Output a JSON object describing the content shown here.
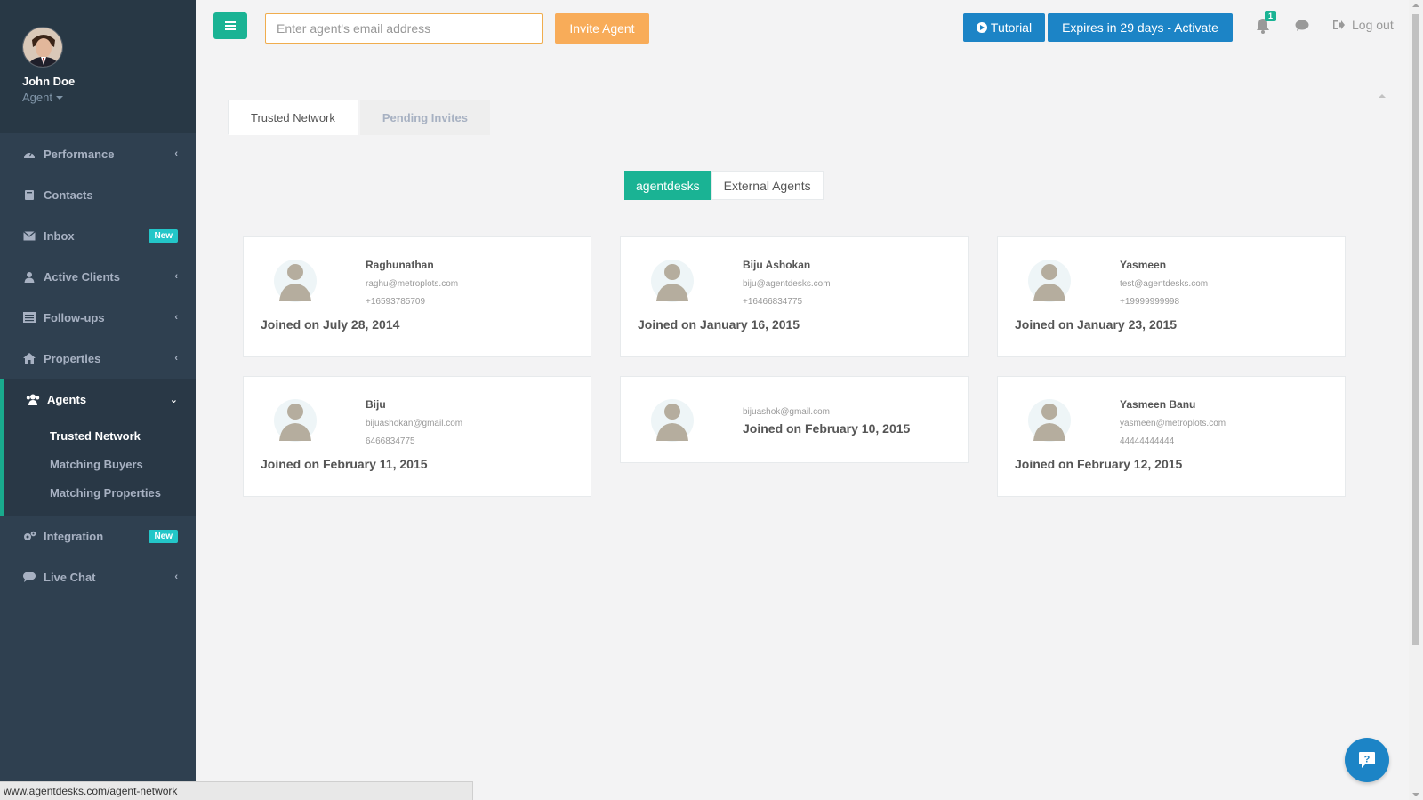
{
  "profile": {
    "name": "John Doe",
    "role": "Agent"
  },
  "sidebar": {
    "items": [
      {
        "label": "Performance",
        "icon": "dashboard-icon"
      },
      {
        "label": "Contacts",
        "icon": "book-icon"
      },
      {
        "label": "Inbox",
        "icon": "envelope-icon",
        "badge": "New"
      },
      {
        "label": "Active Clients",
        "icon": "user-icon"
      },
      {
        "label": "Follow-ups",
        "icon": "list-icon"
      },
      {
        "label": "Properties",
        "icon": "home-icon"
      },
      {
        "label": "Agents",
        "icon": "users-icon"
      },
      {
        "label": "Integration",
        "icon": "gears-icon",
        "badge": "New"
      },
      {
        "label": "Live Chat",
        "icon": "comment-icon"
      }
    ],
    "agents_sub": [
      "Trusted Network",
      "Matching Buyers",
      "Matching Properties"
    ]
  },
  "topbar": {
    "email_placeholder": "Enter agent's email address",
    "invite_label": "Invite Agent",
    "tutorial_label": "Tutorial",
    "expires_label": "Expires in 29 days - Activate",
    "notification_count": "1",
    "logout_label": "Log out"
  },
  "tabs": {
    "trusted": "Trusted Network",
    "pending": "Pending Invites"
  },
  "segments": {
    "on": "agentdesks",
    "off": "External Agents"
  },
  "agents": [
    {
      "name": "Raghunathan",
      "email": "raghu@metroplots.com",
      "phone": "+16593785709",
      "joined": "Joined on July 28, 2014"
    },
    {
      "name": "Biju Ashokan",
      "email": "biju@agentdesks.com",
      "phone": "+16466834775",
      "joined": "Joined on January 16, 2015"
    },
    {
      "name": "Yasmeen",
      "email": "test@agentdesks.com",
      "phone": "+19999999998",
      "joined": "Joined on January 23, 2015"
    },
    {
      "name": "Biju",
      "email": "bijuashokan@gmail.com",
      "phone": "6466834775",
      "joined": "Joined on February 11, 2015"
    },
    {
      "name": "",
      "email": "bijuashok@gmail.com",
      "phone": "",
      "joined": "Joined on February 10, 2015"
    },
    {
      "name": "Yasmeen Banu",
      "email": "yasmeen@metroplots.com",
      "phone": "44444444444",
      "joined": "Joined on February 12, 2015"
    }
  ],
  "status_url": "www.agentdesks.com/agent-network",
  "colors": {
    "sidebar": "#2f4050",
    "primary": "#1ab394",
    "warning": "#f8ac59",
    "info": "#1c84c6",
    "badge": "#23c6c8"
  }
}
